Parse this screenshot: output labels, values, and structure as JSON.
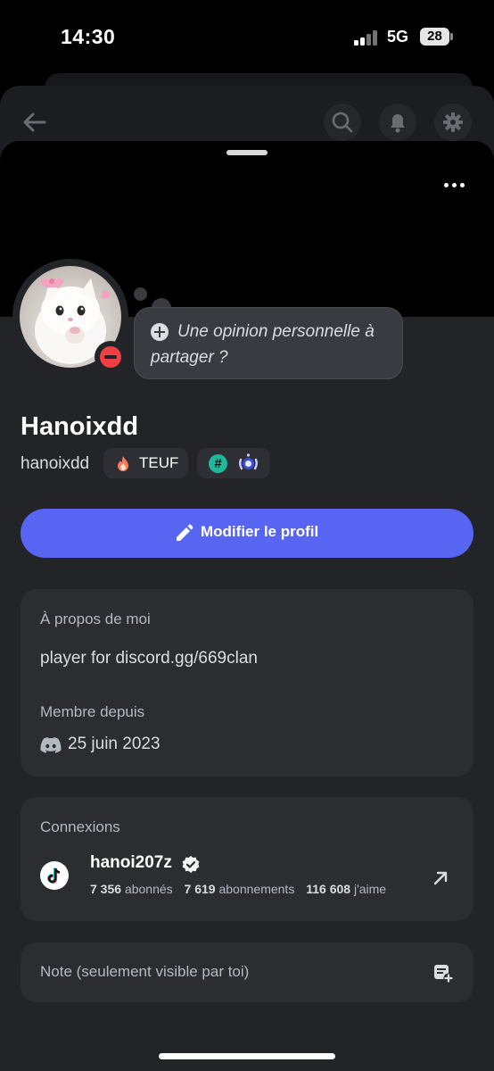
{
  "status_bar": {
    "time": "14:30",
    "network": "5G",
    "battery": "28"
  },
  "header": {
    "back_icon": "arrow-left-icon",
    "search_icon": "search-icon",
    "bell_icon": "bell-icon",
    "settings_icon": "gear-icon",
    "more_icon": "more-horizontal-icon"
  },
  "profile": {
    "display_name": "Hanoixdd",
    "username": "hanoixdd",
    "status": "dnd",
    "status_prompt": "Une opinion personnelle à partager ?",
    "tag": {
      "icon": "flame-icon",
      "label": "TEUF"
    },
    "badges": [
      "hashtag-badge-icon",
      "laurel-badge-icon"
    ]
  },
  "edit_button": {
    "label": "Modifier le profil",
    "icon": "pencil-icon"
  },
  "about": {
    "title": "À propos de moi",
    "bio": "player for discord.gg/669clan",
    "member_since_title": "Membre depuis",
    "member_since_date": "25 juin 2023",
    "member_since_icon": "discord-logo-icon"
  },
  "connections": {
    "title": "Connexions",
    "items": [
      {
        "platform_icon": "tiktok-icon",
        "name": "hanoi207z",
        "verified": true,
        "followers": "7 356",
        "followers_label": "abonnés",
        "following": "7 619",
        "following_label": "abonnements",
        "likes": "116 608",
        "likes_label": "j'aime"
      }
    ]
  },
  "note": {
    "placeholder": "Note (seulement visible par toi)",
    "icon": "note-add-icon"
  },
  "colors": {
    "accent": "#5865f2",
    "dnd": "#f23f43",
    "sheet": "#232428",
    "card": "#2b2d31"
  }
}
